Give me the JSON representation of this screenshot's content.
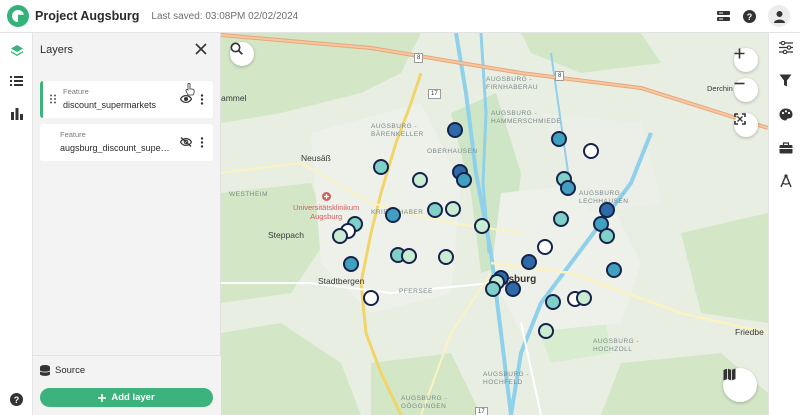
{
  "app": {
    "project_title": "Project Augsburg",
    "saved_text": "Last saved: 03:08PM 02/02/2024",
    "accent": "#3cb37d"
  },
  "topbar_icons": [
    "data-icon",
    "help-icon",
    "user-icon"
  ],
  "left_rail": {
    "items": [
      "layers-icon",
      "list-icon",
      "chart-icon"
    ],
    "help": "help-icon"
  },
  "layers_panel": {
    "title": "Layers",
    "layers": [
      {
        "type": "Feature",
        "name": "discount_supermarkets",
        "visible": true,
        "active": true
      },
      {
        "type": "Feature",
        "name": "augsburg_discount_supermarkets",
        "visible": false,
        "active": false
      }
    ],
    "source_label": "Source",
    "add_layer_label": "Add layer"
  },
  "map": {
    "labels": {
      "ammel": "ammel",
      "neusaess": "Neusäß",
      "westheim": "WESTHEIM",
      "uniklinikum": "Universitätsklinikum\nAugsburg",
      "kriegshaber": "KRIEGSHABER",
      "steppach": "Steppach",
      "stadtbergen": "Stadtbergen",
      "pfersee": "PFERSEE",
      "augsburg": "Augsburg",
      "oberhausen": "OBERHAUSEN",
      "augsburg_baerenkeller": "AUGSBURG -\nBÄRENKELLER",
      "augsburg_firnhaberau": "AUGSBURG -\nFIRNHABERAU",
      "augsburg_hammerschmiede": "AUGSBURG -\nHAMMERSCHMIEDE",
      "augsburg_lechhausen": "AUGSBURG -\nLECHHAUSEN",
      "augsburg_hochzoll": "AUGSBURG -\nHOCHZOLL",
      "augsburg_hochfeld": "AUGSBURG -\nHOCHFELD",
      "augsburg_goeggingen": "AUGSBURG -\nGÖGGINGEN",
      "derching": "Derchin",
      "friedberg": "Friedbe"
    },
    "road_shields": [
      "8",
      "8",
      "17",
      "17"
    ],
    "marker_colors": {
      "light": "#c9ecd3",
      "mid": "#7fd0c6",
      "teal": "#3fa0bf",
      "dark": "#2f6aa8",
      "white": "#ffffff",
      "stroke": "#16224a"
    },
    "controls": [
      "search-icon",
      "zoom-in-icon",
      "zoom-out-icon",
      "fit-bounds-icon",
      "basemap-icon"
    ]
  },
  "right_rail": {
    "items": [
      "settings-sliders-icon",
      "filter-icon",
      "palette-icon",
      "toolbox-icon",
      "analysis-icon"
    ]
  }
}
